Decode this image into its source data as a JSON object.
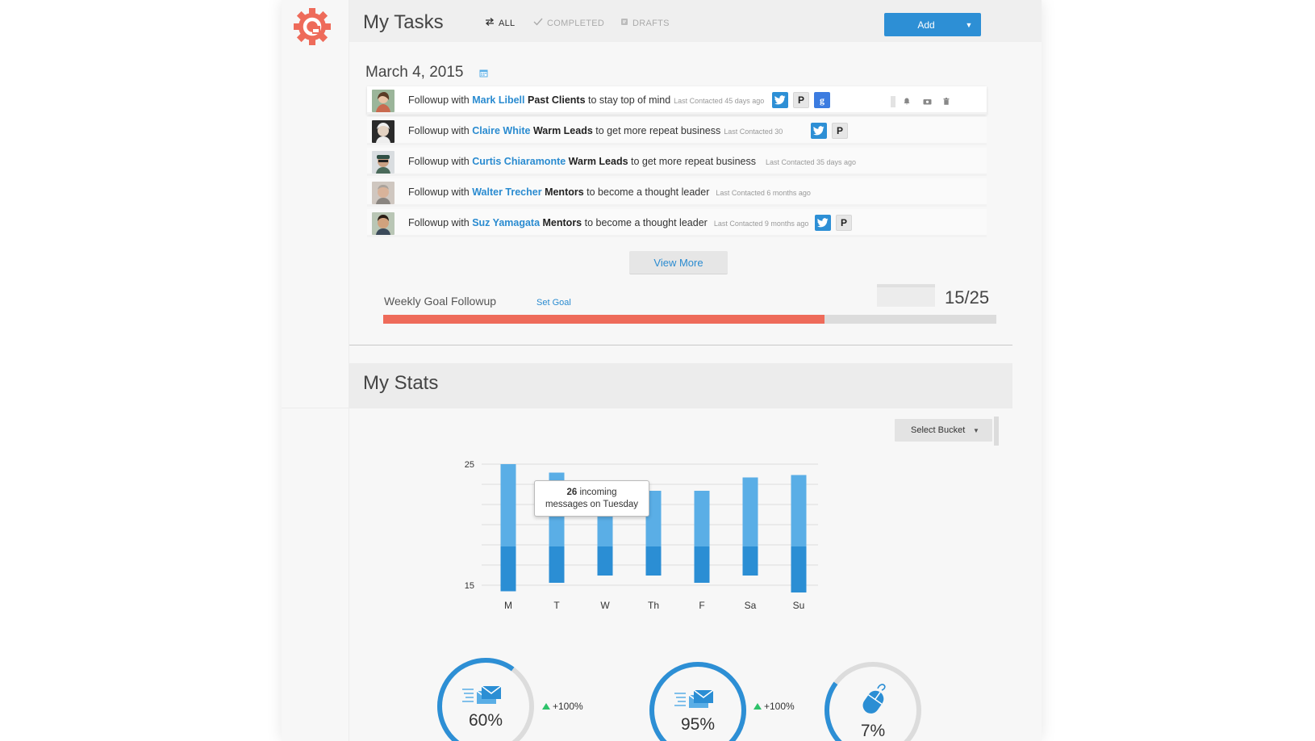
{
  "header": {
    "title": "My Tasks",
    "tabs": [
      {
        "label": "ALL",
        "icon": "swap-arrows-icon",
        "active": true
      },
      {
        "label": "COMPLETED",
        "icon": "check-icon",
        "active": false
      },
      {
        "label": "DRAFTS",
        "icon": "draft-icon",
        "active": false
      }
    ],
    "add_label": "Add"
  },
  "tasks": {
    "date": "March 4, 2015",
    "rows": [
      {
        "prefix": "Followup with ",
        "name": "Mark Libell",
        "bucket": "Past Clients",
        "goal": " to stay top of mind",
        "last_contacted": "Last Contacted 45 days ago",
        "social": [
          "twitter",
          "producthunt",
          "google"
        ]
      },
      {
        "prefix": "Followup with ",
        "name": "Claire White",
        "bucket": " Warm Leads",
        "goal": " to get more repeat business",
        "last_contacted": "Last Contacted 30",
        "social": [
          "twitter",
          "producthunt"
        ]
      },
      {
        "prefix": "Followup with ",
        "name": "Curtis Chiaramonte",
        "bucket": " Warm Leads",
        "goal": " to get more repeat business",
        "last_contacted": "Last Contacted  35 days ago",
        "social": []
      },
      {
        "prefix": "Followup with ",
        "name": "Walter Trecher",
        "bucket": " Mentors",
        "goal": " to become a thought leader",
        "last_contacted": "Last Contacted 6 months ago",
        "social": []
      },
      {
        "prefix": "Followup with ",
        "name": "Suz Yamagata",
        "bucket": " Mentors",
        "goal": " to become a thought leader",
        "last_contacted": "Last Contacted 9 months ago",
        "social": [
          "twitter",
          "producthunt"
        ]
      }
    ],
    "view_more_label": "View More"
  },
  "goal": {
    "label": "Weekly Goal Followup",
    "set_goal_label": "Set Goal",
    "count_text": "15/25",
    "progress": 0.72
  },
  "stats": {
    "title": "My Stats",
    "bucket_select": "Select Bucket",
    "tooltip": {
      "count": "26",
      "line1_rest": " incoming",
      "line2": "messages on Tuesday"
    },
    "donuts": [
      {
        "value": "60%",
        "fraction": 0.6,
        "icon": "email-send-icon",
        "delta": "+100%"
      },
      {
        "value": "95%",
        "fraction": 0.95,
        "icon": "email-send-icon",
        "delta": "+100%"
      },
      {
        "value": "7%",
        "fraction": 0.07,
        "icon": "mouse-click-icon",
        "delta": ""
      }
    ]
  },
  "colors": {
    "accent": "#2d8fd5",
    "progress": "#ee6b5a",
    "bar_light": "#5aaee6",
    "bar_dark": "#2b8ed4",
    "positive": "#2ec26a",
    "logo": "#ee6b5a"
  },
  "chart_data": {
    "type": "bar",
    "categories": [
      "M",
      "T",
      "W",
      "Th",
      "F",
      "Sa",
      "Su"
    ],
    "series": [
      {
        "values": [
          25.0,
          24.3,
          23.2,
          22.8,
          22.8,
          23.9,
          24.1
        ]
      },
      {
        "values": [
          14.5,
          15.2,
          15.8,
          15.8,
          15.2,
          15.8,
          14.4
        ]
      }
    ],
    "ylim": [
      15,
      25
    ],
    "split_value": 18.2,
    "y_ticks": [
      15,
      25
    ],
    "grid": true
  }
}
